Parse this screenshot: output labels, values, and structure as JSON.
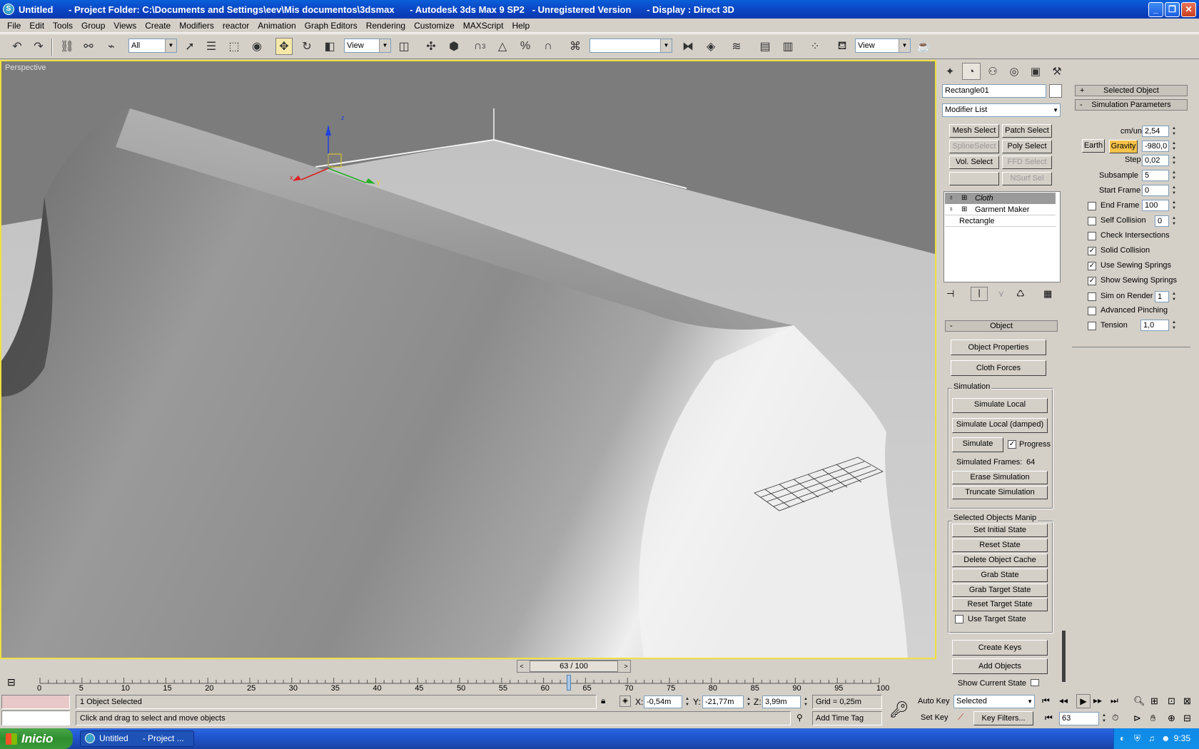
{
  "window": {
    "title": "Untitled      - Project Folder: C:\\Documents and Settings\\eev\\Mis documentos\\3dsmax      - Autodesk 3ds Max 9 SP2   - Unregistered Version      - Display : Direct 3D",
    "controls": [
      "_",
      "❐",
      "✕"
    ]
  },
  "menu": [
    "File",
    "Edit",
    "Tools",
    "Group",
    "Views",
    "Create",
    "Modifiers",
    "reactor",
    "Animation",
    "Graph Editors",
    "Rendering",
    "Customize",
    "MAXScript",
    "Help"
  ],
  "toolbar": {
    "selection_filter": "All",
    "ref_coord": "View",
    "named_selection": "",
    "viewport_dropdown": "View",
    "snap_label": "3"
  },
  "viewport": {
    "label": "Perspective",
    "gizmo_axes": [
      "x",
      "y",
      "z"
    ]
  },
  "command_panel": {
    "object_name": "Rectangle01",
    "modifier_list": "Modifier List",
    "modifier_buttons": [
      {
        "label": "Mesh Select",
        "enabled": true
      },
      {
        "label": "Patch Select",
        "enabled": true
      },
      {
        "label": "SplineSelect",
        "enabled": false
      },
      {
        "label": "Poly Select",
        "enabled": true
      },
      {
        "label": "Vol. Select",
        "enabled": true
      },
      {
        "label": "FFD Select",
        "enabled": false
      },
      {
        "label": "",
        "enabled": false
      },
      {
        "label": "NSurf Sel",
        "enabled": false
      }
    ],
    "stack": [
      "Cloth",
      "Garment Maker",
      "Rectangle"
    ],
    "object_rollout": {
      "title": "Object",
      "object_properties": "Object Properties",
      "cloth_forces": "Cloth Forces",
      "simulation_group": "Simulation",
      "simulate_local": "Simulate Local",
      "simulate_local_damped": "Simulate Local (damped)",
      "simulate": "Simulate",
      "progress": "Progress",
      "simulated_frames_label": "Simulated Frames:",
      "simulated_frames_value": "64",
      "erase_simulation": "Erase Simulation",
      "truncate_simulation": "Truncate Simulation",
      "manip_group": "Selected Objects Manip",
      "set_initial_state": "Set Initial State",
      "reset_state": "Reset State",
      "delete_object_cache": "Delete Object Cache",
      "grab_state": "Grab State",
      "grab_target_state": "Grab Target State",
      "reset_target_state": "Reset Target State",
      "use_target_state": "Use Target State",
      "create_keys": "Create Keys",
      "add_objects": "Add Objects",
      "show_current_state": "Show Current State"
    },
    "sim_params": {
      "selected_object": "Selected Object",
      "title": "Simulation Parameters",
      "cm_unit_label": "cm/unit",
      "cm_unit": "2,54",
      "earth": "Earth",
      "gravity": "Gravity",
      "gravity_value": "-980,0",
      "step_label": "Step",
      "step": "0,02",
      "subsample_label": "Subsample",
      "subsample": "5",
      "start_frame_label": "Start Frame",
      "start_frame": "0",
      "end_frame_label": "End Frame",
      "end_frame": "100",
      "self_collision_label": "Self Collision",
      "self_collision": "0",
      "check_intersections": "Check Intersections",
      "solid_collision": "Solid Collision",
      "use_sewing_springs": "Use Sewing Springs",
      "show_sewing_springs": "Show Sewing Springs",
      "sim_on_render": "Sim on Render",
      "sim_on_render_value": "1",
      "advanced_pinching": "Advanced Pinching",
      "tension": "Tension",
      "tension_value": "1,0"
    }
  },
  "timeline": {
    "slider_label": "63 / 100",
    "current_frame": 63,
    "total_frames": 100,
    "ticks": [
      "0",
      "5",
      "10",
      "15",
      "20",
      "25",
      "30",
      "35",
      "40",
      "45",
      "50",
      "55",
      "60",
      "65",
      "70",
      "75",
      "80",
      "85",
      "90",
      "95",
      "100"
    ]
  },
  "status": {
    "selection": "1 Object Selected",
    "prompt": "Click and drag to select and move objects",
    "x_label": "X:",
    "x": "-0,54m",
    "y_label": "Y:",
    "y": "-21,77m",
    "z_label": "Z:",
    "z": "3,99m",
    "grid": "Grid = 0,25m",
    "add_time_tag": "Add Time Tag",
    "auto_key": "Auto Key",
    "set_key": "Set Key",
    "selected": "Selected",
    "key_filters": "Key Filters...",
    "frame": "63"
  },
  "taskbar": {
    "start": "Inicio",
    "task": "Untitled      - Project ...",
    "clock": "9:35"
  },
  "colors": {
    "viewport_border": "#f0e040",
    "gravity_highlight": "#f5c24a",
    "active_tool": "#f6e8a8"
  }
}
